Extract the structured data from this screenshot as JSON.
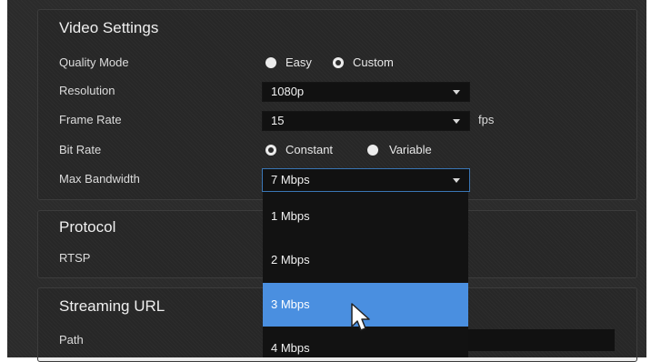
{
  "video_settings": {
    "title": "Video Settings",
    "quality_mode": {
      "label": "Quality Mode",
      "options": [
        "Easy",
        "Custom"
      ],
      "selected": "Custom"
    },
    "resolution": {
      "label": "Resolution",
      "value": "1080p"
    },
    "frame_rate": {
      "label": "Frame Rate",
      "value": "15",
      "unit": "fps"
    },
    "bit_rate": {
      "label": "Bit Rate",
      "options": [
        "Constant",
        "Variable"
      ],
      "selected": "Constant"
    },
    "max_bandwidth": {
      "label": "Max Bandwidth",
      "value": "7 Mbps"
    }
  },
  "protocol": {
    "title": "Protocol",
    "rtsp_label": "RTSP"
  },
  "streaming_url": {
    "title": "Streaming URL",
    "path_label": "Path",
    "path_value": ""
  },
  "bandwidth_dropdown": {
    "options": [
      "1 Mbps",
      "2 Mbps",
      "3 Mbps",
      "4 Mbps"
    ],
    "highlighted": "3 Mbps"
  },
  "icons": [
    "chevron-down-icon",
    "mouse-pointer-icon"
  ],
  "colors": {
    "background": "#2b2b2b",
    "input_bg": "#111111",
    "highlight": "#4a8fe0",
    "focus_border": "#3a76b5"
  }
}
